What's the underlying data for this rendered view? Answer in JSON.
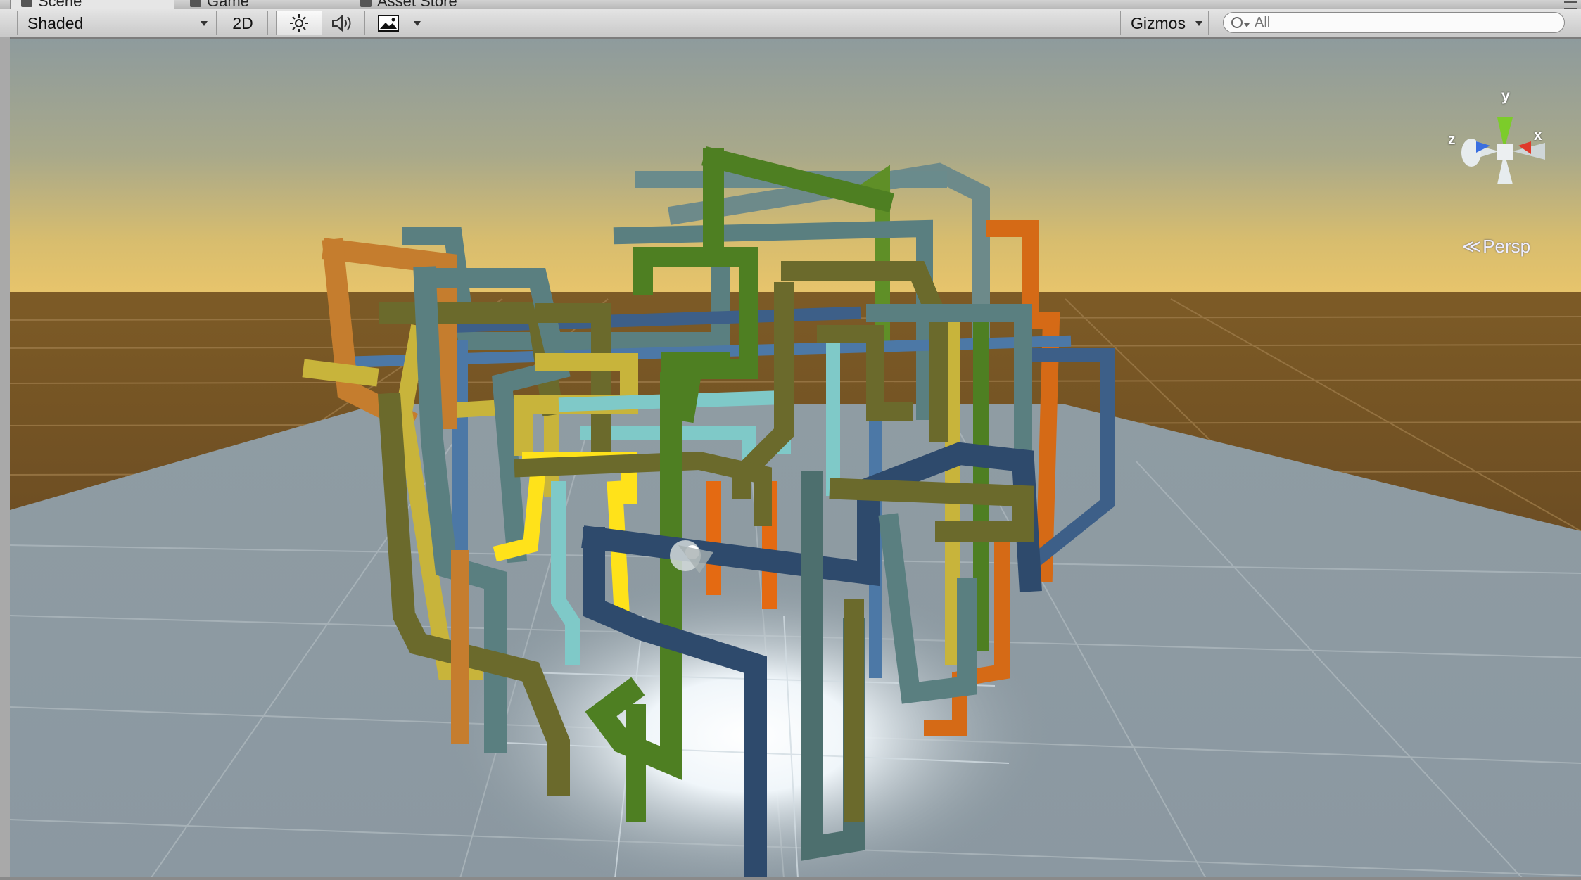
{
  "tabs": {
    "scene": "Scene",
    "game": "Game",
    "asset_store": "Asset Store"
  },
  "toolbar": {
    "shading_mode": "Shaded",
    "mode_2d": "2D",
    "gizmos": "Gizmos",
    "search_placeholder": "All",
    "icons": [
      "sun-icon",
      "speaker-icon",
      "image-icon",
      "chevron-down-icon",
      "search-icon"
    ]
  },
  "gizmo": {
    "x_label": "x",
    "y_label": "y",
    "z_label": "z",
    "projection": "Persp",
    "colors": {
      "x": "#e03a2a",
      "y": "#7ccc2a",
      "z": "#3a6fe0"
    }
  },
  "scene": {
    "sky_top": "#8e9a9b",
    "horizon": "#e6c56e",
    "ground_far": "#6e5127",
    "ground_near": "#8d9aa4",
    "pipe_colors": [
      "#c57d2e",
      "#5a7f80",
      "#4e7f22",
      "#c8b43b",
      "#3d5f88",
      "#7fc9c8",
      "#e46a12",
      "#6b6a2c",
      "#ffe21a"
    ]
  }
}
